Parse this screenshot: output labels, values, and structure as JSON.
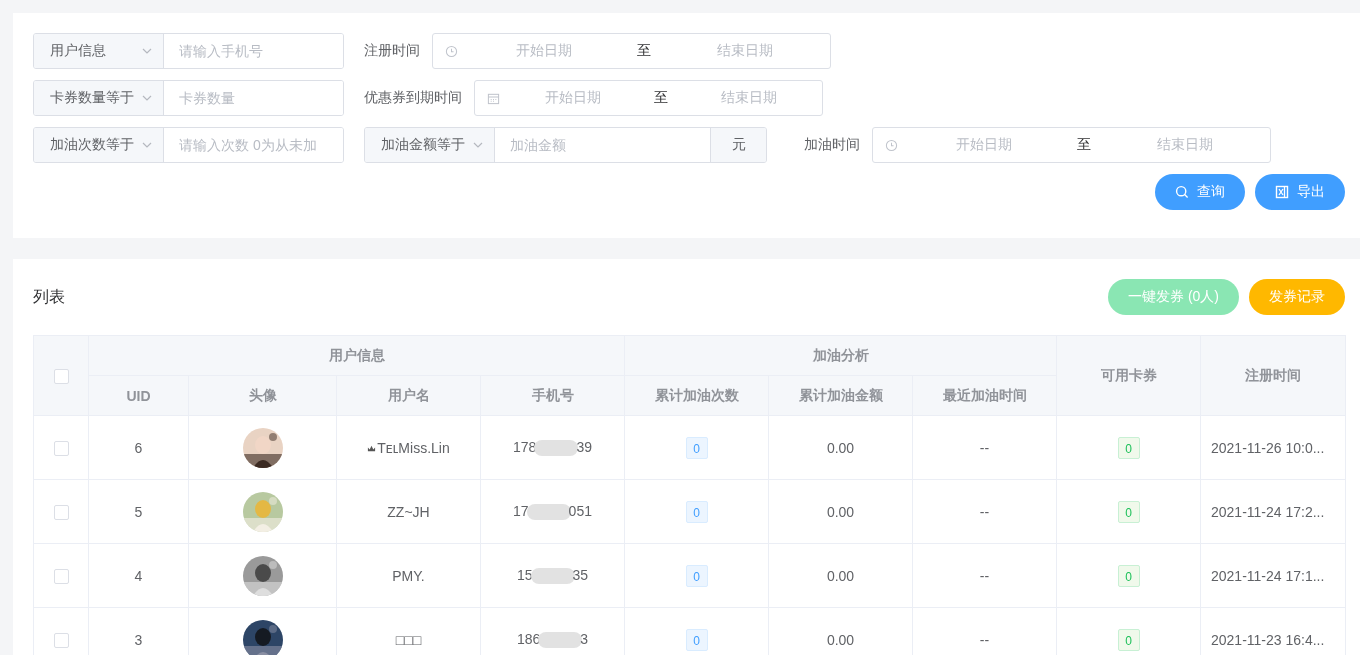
{
  "filters": [
    {
      "kind": "select-input",
      "select": "用户信息",
      "placeholder": "请输入手机号"
    },
    {
      "kind": "datetime-range",
      "label": "注册时间",
      "start_placeholder": "开始日期",
      "separator": "至",
      "end_placeholder": "结束日期"
    },
    {
      "kind": "select-input",
      "select": "卡券数量等于",
      "placeholder": "卡券数量"
    },
    {
      "kind": "date-range",
      "label": "优惠券到期时间",
      "start_placeholder": "开始日期",
      "separator": "至",
      "end_placeholder": "结束日期"
    },
    {
      "kind": "select-input",
      "select": "加油次数等于",
      "placeholder": "请输入次数 0为从未加"
    },
    {
      "kind": "select-input-append",
      "select": "加油金额等于",
      "placeholder": "加油金额",
      "append": "元"
    },
    {
      "kind": "datetime-range",
      "label": "加油时间",
      "start_placeholder": "开始日期",
      "separator": "至",
      "end_placeholder": "结束日期"
    }
  ],
  "filter_buttons": [
    {
      "kind": "search",
      "label": "查询"
    },
    {
      "kind": "export",
      "label": "导出"
    }
  ],
  "list": {
    "title": "列表",
    "actions": [
      {
        "kind": "success",
        "label": "一键发券 (0人)",
        "disabled": true
      },
      {
        "kind": "warning",
        "label": "发券记录",
        "disabled": false
      }
    ],
    "table": {
      "select_all": {
        "checked": false
      },
      "groups": [
        "用户信息",
        "加油分析"
      ],
      "columns": [
        "UID",
        "头像",
        "用户名",
        "手机号",
        "累计加油次数",
        "累计加油金额",
        "最近加油时间",
        "可用卡券",
        "注册时间"
      ],
      "rows": [
        {
          "checked": false,
          "uid": "6",
          "badge": true,
          "username": "TᴇʟMiss.Lin",
          "phone_start": "178",
          "phone_end": "39",
          "count": "0",
          "amount": "0.00",
          "recent": "--",
          "coupons": "0",
          "registered": "2021-11-26 10:0..."
        },
        {
          "checked": false,
          "uid": "5",
          "badge": false,
          "username": "ZZ~JH",
          "phone_start": "17",
          "phone_end": "051",
          "count": "0",
          "amount": "0.00",
          "recent": "--",
          "coupons": "0",
          "registered": "2021-11-24 17:2..."
        },
        {
          "checked": false,
          "uid": "4",
          "badge": false,
          "username": "PMY.",
          "phone_start": "15",
          "phone_end": "35",
          "count": "0",
          "amount": "0.00",
          "recent": "--",
          "coupons": "0",
          "registered": "2021-11-24 17:1..."
        },
        {
          "checked": false,
          "uid": "3",
          "badge": false,
          "username": "□□□",
          "phone_start": "186",
          "phone_end": "3",
          "count": "0",
          "amount": "0.00",
          "recent": "--",
          "coupons": "0",
          "registered": "2021-11-23 16:4..."
        }
      ]
    }
  }
}
